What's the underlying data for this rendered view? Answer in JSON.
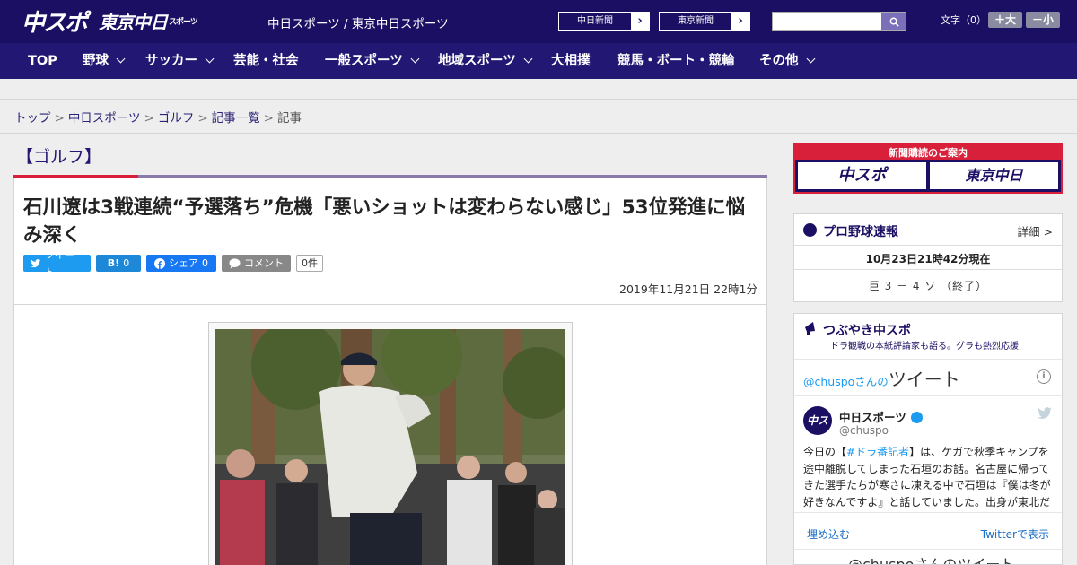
{
  "header": {
    "logo_chuspo": "中スポ",
    "logo_tokyo": "東京中日",
    "logo_tokyo_small": "スポーツ",
    "site_names": "中日スポーツ / 東京中日スポーツ",
    "link_chunichi": "中日新聞",
    "link_tokyo": "東京新聞",
    "search_placeholder": "",
    "font_label": "文字（0）",
    "font_up": "＋大",
    "font_down": "－小"
  },
  "nav": {
    "items": [
      {
        "label": "TOP",
        "dropdown": false
      },
      {
        "label": "野球",
        "dropdown": true
      },
      {
        "label": "サッカー",
        "dropdown": true
      },
      {
        "label": "芸能・社会",
        "dropdown": false
      },
      {
        "label": "一般スポーツ",
        "dropdown": true
      },
      {
        "label": "地域スポーツ",
        "dropdown": true
      },
      {
        "label": "大相撲",
        "dropdown": false
      },
      {
        "label": "競馬・ボート・競輪",
        "dropdown": false
      },
      {
        "label": "その他",
        "dropdown": true
      }
    ]
  },
  "breadcrumb": {
    "top": "トップ",
    "chunichi": "中日スポーツ",
    "golf": "ゴルフ",
    "list": "記事一覧",
    "current": "記事"
  },
  "article": {
    "category": "【ゴルフ】",
    "headline": "石川遼は3戦連続“予選落ち”危機「悪いショットは変わらない感じ」53位発進に悩み深く",
    "share_tweet": "ツイート",
    "share_hatena": "B!",
    "share_hatena_count": "0",
    "share_facebook": "シェア",
    "share_facebook_count": "0",
    "share_comment": "コメント",
    "comment_count": "0件",
    "date": "2019年11月21日 22時1分"
  },
  "sidebar": {
    "subscribe_title": "新聞購読のご案内",
    "subscribe_logo1": "中スポ",
    "subscribe_logo2": "東京中日",
    "baseball_title": "プロ野球速報",
    "baseball_detail": "詳細 >",
    "baseball_time": "10月23日21時42分現在",
    "baseball_score": "巨 3 － 4 ソ （終了）",
    "tweets_title": "つぶやき中スポ",
    "tweets_subtitle": "ドラ観戦の本紙評論家も語る。グラも熱烈応援",
    "tweets_header_handle": "@chuspoさんの",
    "tweets_header_big": "ツイート",
    "tweet_avatar": "中スポ",
    "tweet_name": "中日スポーツ",
    "tweet_handle": "@chuspo",
    "tweet_body_pre": "今日の【",
    "tweet_body_tag": "#ドラ番記者",
    "tweet_body_post": "】は、ケガで秋季キャンプを途中離脱してしまった石垣のお話。名古屋に帰ってきた選手たちが寒さに凍える中で石垣は『僕は冬が好きなんですよ』と話していました。出身が東北だ",
    "embed_link": "埋め込む",
    "view_link": "Twitterで表示",
    "footer": "@chuspoさんのツイート"
  },
  "colors": {
    "header_bg": "#1a0f63",
    "nav_bg": "#221772",
    "accent_red": "#d8203a",
    "twitter_blue": "#1d9bf0"
  }
}
